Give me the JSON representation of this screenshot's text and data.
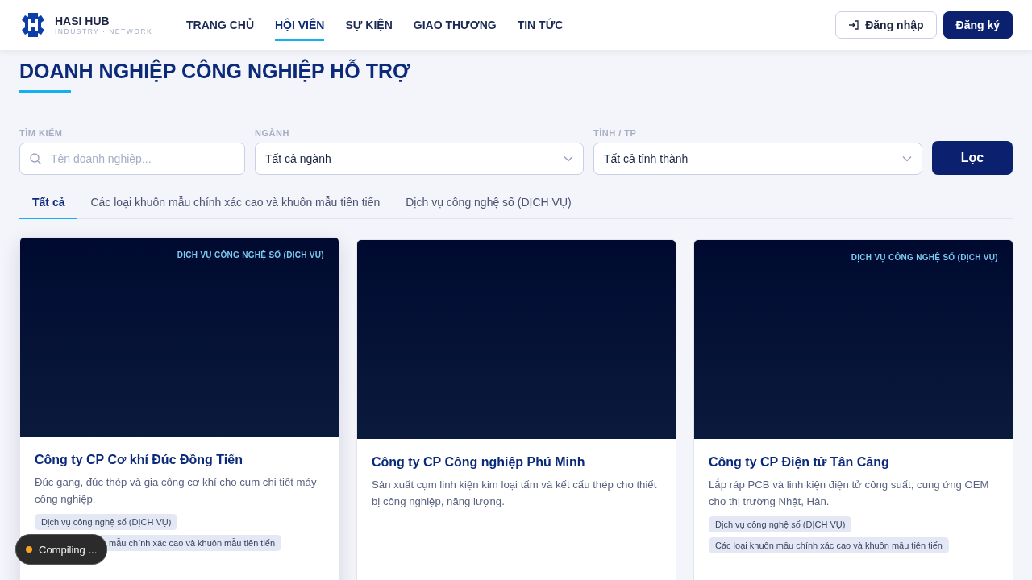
{
  "brand": {
    "name": "HASI HUB",
    "tagline": "INDUSTRY · NETWORK"
  },
  "nav": [
    {
      "label": "TRANG CHỦ",
      "selected": false
    },
    {
      "label": "HỘI VIÊN",
      "selected": true
    },
    {
      "label": "SỰ KIỆN",
      "selected": false
    },
    {
      "label": "GIAO THƯƠNG",
      "selected": false
    },
    {
      "label": "TIN TỨC",
      "selected": false
    }
  ],
  "login": "Đăng nhập",
  "register": "Đăng ký",
  "page_title": "DOANH NGHIỆP CÔNG NGHIỆP HỖ TRỢ",
  "filters": {
    "search": {
      "label": "TÌM KIẾM",
      "placeholder": "Tên doanh nghiệp..."
    },
    "industry": {
      "label": "NGÀNH",
      "value": "Tất cả ngành"
    },
    "province": {
      "label": "TỈNH / TP",
      "value": "Tất cả tỉnh thành"
    },
    "button": "Lọc"
  },
  "tabs": [
    {
      "label": "Tất cả",
      "selected": true
    },
    {
      "label": "Các loại khuôn mẫu chính xác cao và khuôn mẫu tiên tiến",
      "selected": false
    },
    {
      "label": "Dịch vụ công nghệ số (DỊCH VỤ)",
      "selected": false
    }
  ],
  "cards": [
    {
      "category": "DỊCH VỤ CÔNG NGHỆ SỐ (DỊCH VỤ)",
      "name": "Công ty CP Cơ khí Đúc Đồng Tiến",
      "description": "Đúc gang, đúc thép và gia công cơ khí cho cụm chi tiết máy công nghiệp.",
      "tags": [
        {
          "label": "Dịch vụ công nghệ số (DỊCH VỤ)",
          "covered": false
        },
        {
          "label": "mẫu chính xác cao và khuôn mẫu tiên tiến",
          "covered": true
        }
      ],
      "hovered": true
    },
    {
      "name": "Công ty CP Công nghiệp Phú Minh",
      "description": "Sản xuất cụm linh kiện kim loại tấm và kết cấu thép cho thiết bị công nghiệp, năng lượng.",
      "hovered": false
    },
    {
      "category": "DỊCH VỤ CÔNG NGHỆ SỐ (DỊCH VỤ)",
      "name": "Công ty CP Điện tử Tân Cảng",
      "description": "Lắp ráp PCB và linh kiện điện tử công suất, cung ứng OEM cho thị trường Nhật, Hàn.",
      "tags": [
        {
          "label": "Dịch vụ công nghệ số (DỊCH VỤ)",
          "covered": false
        },
        {
          "label": "Các loại khuôn mẫu chính xác cao và khuôn mẫu tiên tiến",
          "covered": false
        }
      ],
      "hovered": false
    }
  ],
  "toast": {
    "label": "Compiling ..."
  }
}
